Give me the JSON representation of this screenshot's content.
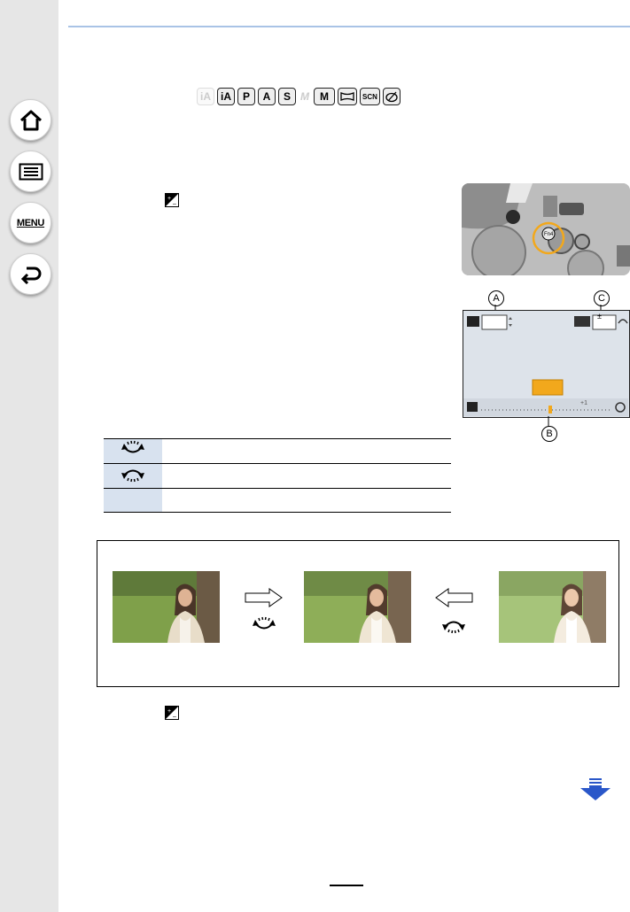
{
  "sidebar": {
    "home_icon": "home-icon",
    "contents_icon": "list-icon",
    "menu_label": "MENU",
    "back_icon": "back-arrow-icon"
  },
  "mode_icons": {
    "items": [
      "iA",
      "iA",
      "P",
      "A",
      "S",
      "M",
      "M",
      "",
      "SCN",
      ""
    ]
  },
  "lcd": {
    "callouts": [
      "A",
      "B",
      "C"
    ],
    "scale_label": "+1",
    "flash_label": "±"
  },
  "operation_table": {
    "rows": [
      {
        "icon": "dial-right-icon",
        "text": ""
      },
      {
        "icon": "dial-left-icon",
        "text": ""
      },
      {
        "icon": "",
        "text": ""
      }
    ]
  },
  "colors": {
    "sidebar_bg": "#e6e6e6",
    "header_line": "#a9c3e6",
    "table_icon_bg": "#d8e2ef",
    "highlight": "#f2a81c",
    "next_arrow": "#2a57c9"
  }
}
